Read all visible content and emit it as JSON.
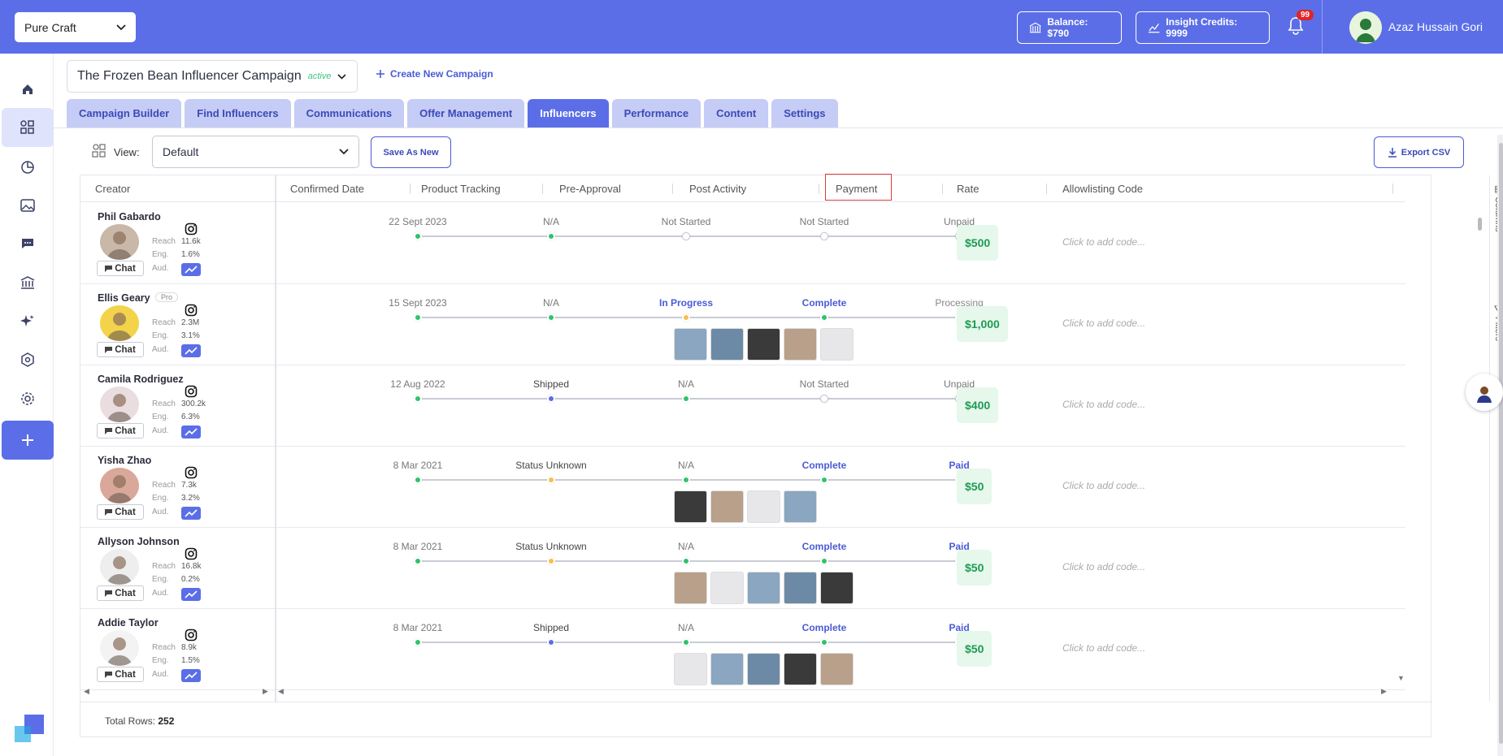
{
  "topbar": {
    "brand": "Pure Craft",
    "balance": "Balance: $790",
    "credits": "Insight Credits: 9999",
    "notifications": "99",
    "user_name": "Azaz Hussain Gori",
    "colors": {
      "primary": "#5b6ee8"
    }
  },
  "sidebar": {
    "items": [
      "home-icon",
      "campaigns-icon",
      "analytics-icon",
      "media-icon",
      "chat-icon",
      "bank-icon",
      "sparkle-icon",
      "shield-icon",
      "gear-icon",
      "plus-icon"
    ]
  },
  "campaign": {
    "title": "The Frozen Bean Influencer Campaign",
    "status": "active",
    "create_label": "Create New Campaign"
  },
  "tabs": [
    "Campaign Builder",
    "Find Influencers",
    "Communications",
    "Offer Management",
    "Influencers",
    "Performance",
    "Content",
    "Settings"
  ],
  "active_tab": "Influencers",
  "toolbar": {
    "view_label": "View:",
    "view_value": "Default",
    "save_label": "Save As New",
    "export_label": "Export CSV"
  },
  "table": {
    "headers": {
      "creator": "Creator",
      "confirmed": "Confirmed Date",
      "tracking": "Product Tracking",
      "preapproval": "Pre-Approval",
      "post": "Post Activity",
      "payment": "Payment",
      "rate": "Rate",
      "allowlisting": "Allowlisting Code"
    },
    "stat_labels": {
      "reach": "Reach",
      "eng": "Eng.",
      "aud": "Aud."
    },
    "chat_label": "Chat",
    "pro_label": "Pro",
    "code_placeholder": "Click to add code...",
    "rows": [
      {
        "name": "Phil Gabardo",
        "reach": "11.6k",
        "eng": "1.6%",
        "confirmed": "22 Sept 2023",
        "tracking": "N/A",
        "preapproval": "Not Started",
        "post": "Not Started",
        "payment": "Unpaid",
        "rate": "$500"
      },
      {
        "name": "Ellis Geary",
        "reach": "2.3M",
        "eng": "3.1%",
        "confirmed": "15 Sept 2023",
        "tracking": "N/A",
        "preapproval": "In Progress",
        "post": "Complete",
        "payment": "Processing",
        "rate": "$1,000"
      },
      {
        "name": "Camila Rodriguez",
        "reach": "300.2k",
        "eng": "6.3%",
        "confirmed": "12 Aug 2022",
        "tracking": "Shipped",
        "preapproval": "N/A",
        "post": "Not Started",
        "payment": "Unpaid",
        "rate": "$400"
      },
      {
        "name": "Yisha Zhao",
        "reach": "7.3k",
        "eng": "3.2%",
        "confirmed": "8 Mar 2021",
        "tracking": "Status Unknown",
        "preapproval": "N/A",
        "post": "Complete",
        "payment": "Paid",
        "rate": "$50"
      },
      {
        "name": "Allyson Johnson",
        "reach": "16.8k",
        "eng": "0.2%",
        "confirmed": "8 Mar 2021",
        "tracking": "Status Unknown",
        "preapproval": "N/A",
        "post": "Complete",
        "payment": "Paid",
        "rate": "$50"
      },
      {
        "name": "Addie Taylor",
        "reach": "8.9k",
        "eng": "1.5%",
        "confirmed": "8 Mar 2021",
        "tracking": "Shipped",
        "preapproval": "N/A",
        "post": "Complete",
        "payment": "Paid",
        "rate": "$50"
      }
    ],
    "side_tools": {
      "columns": "Columns",
      "filters": "Filters"
    },
    "total_label": "Total Rows:",
    "total_value": "252"
  }
}
